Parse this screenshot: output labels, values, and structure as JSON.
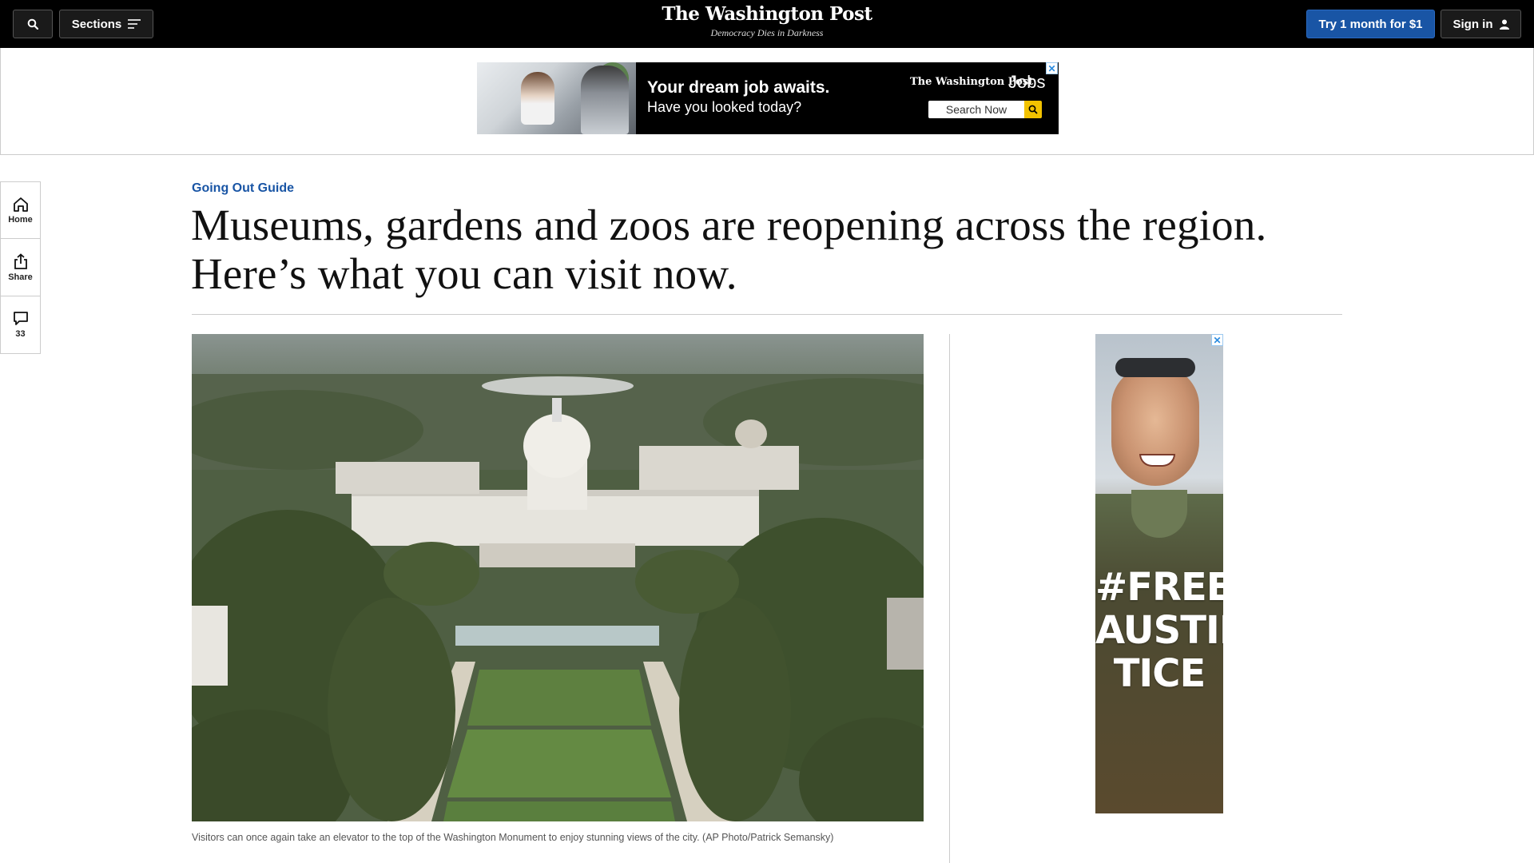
{
  "header": {
    "sections_label": "Sections",
    "logo_text": "The Washington Post",
    "tagline": "Democracy Dies in Darkness",
    "subscribe_label": "Try 1 month for $1",
    "signin_label": "Sign in"
  },
  "top_ad": {
    "headline": "Your dream job awaits.",
    "subhead": "Have you looked today?",
    "brand": "The Washington Post",
    "brand_suffix": "Jobs",
    "search_label": "Search Now"
  },
  "rail": {
    "home_label": "Home",
    "share_label": "Share",
    "comments_count": "33"
  },
  "article": {
    "kicker": "Going Out Guide",
    "headline": "Museums, gardens and zoos are reopening across the region. Here’s what you can visit now.",
    "caption": "Visitors can once again take an elevator to the top of the Washington Monument to enjoy stunning views of the city. (AP Photo/Patrick Semansky)"
  },
  "side_ad": {
    "slogan_line1": "#FREE",
    "slogan_line2": "AUSTIN",
    "slogan_line3": "TICE"
  },
  "icons": {
    "search": "search-icon",
    "sections": "menu-icon",
    "user": "user-icon",
    "home": "home-icon",
    "share": "share-icon",
    "comments": "comment-icon",
    "close_ad": "close-icon"
  },
  "colors": {
    "topbar": "#000000",
    "accent_blue": "#1955a5",
    "ad_search_button": "#f2c200"
  }
}
